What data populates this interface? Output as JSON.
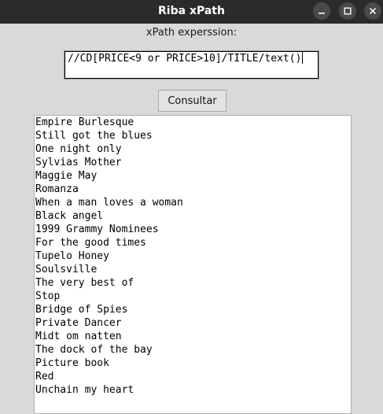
{
  "window": {
    "title": "Riba xPath",
    "minimize_icon": "minimize-icon",
    "maximize_icon": "maximize-icon",
    "close_icon": "close-icon"
  },
  "form": {
    "label": "xPath experssion:",
    "query_value": "//CD[PRICE<9 or PRICE>10]/TITLE/text()",
    "submit_label": "Consultar"
  },
  "results": [
    "Empire Burlesque",
    "Still got the blues",
    "One night only",
    "Sylvias Mother",
    "Maggie May",
    "Romanza",
    "When a man loves a woman",
    "Black angel",
    "1999 Grammy Nominees",
    "For the good times",
    "Tupelo Honey",
    "Soulsville",
    "The very best of",
    "Stop",
    "Bridge of Spies",
    "Private Dancer",
    "Midt om natten",
    "The dock of the bay",
    "Picture book",
    "Red",
    "Unchain my heart"
  ]
}
